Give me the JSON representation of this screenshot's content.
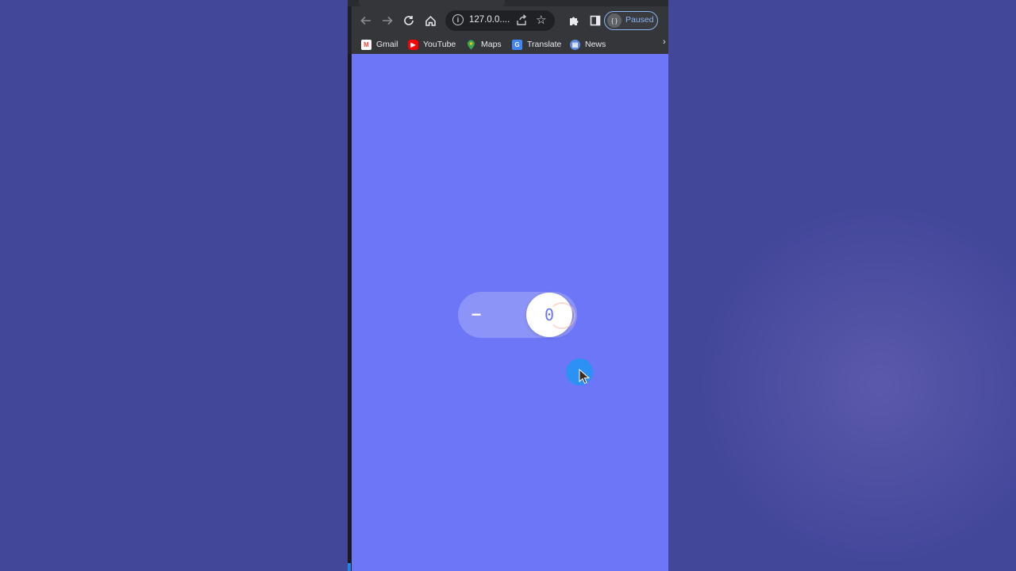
{
  "browser": {
    "toolbar": {
      "back_icon": "arrow-left-icon",
      "forward_icon": "arrow-right-icon",
      "reload_icon": "reload-icon",
      "home_icon": "home-icon",
      "url": "127.0.0....",
      "extensions_icon": "puzzle-icon",
      "sidepanel_icon": "side-panel-icon",
      "profile_label": "Paused",
      "accent": "#8ab4f8"
    },
    "bookmarks": [
      {
        "label": "Gmail",
        "icon": "gmail-icon",
        "color": "#ea4335"
      },
      {
        "label": "YouTube",
        "icon": "youtube-icon",
        "color": "#ff0000"
      },
      {
        "label": "Maps",
        "icon": "maps-icon",
        "color": "#34a853"
      },
      {
        "label": "Translate",
        "icon": "translate-icon",
        "color": "#4285f4"
      },
      {
        "label": "News",
        "icon": "news-icon",
        "color": "#5f8ad9"
      }
    ]
  },
  "page": {
    "background": "#6c76f7",
    "counter": {
      "minus_label": "−",
      "value": "0"
    }
  },
  "outer_background": "#43479a"
}
